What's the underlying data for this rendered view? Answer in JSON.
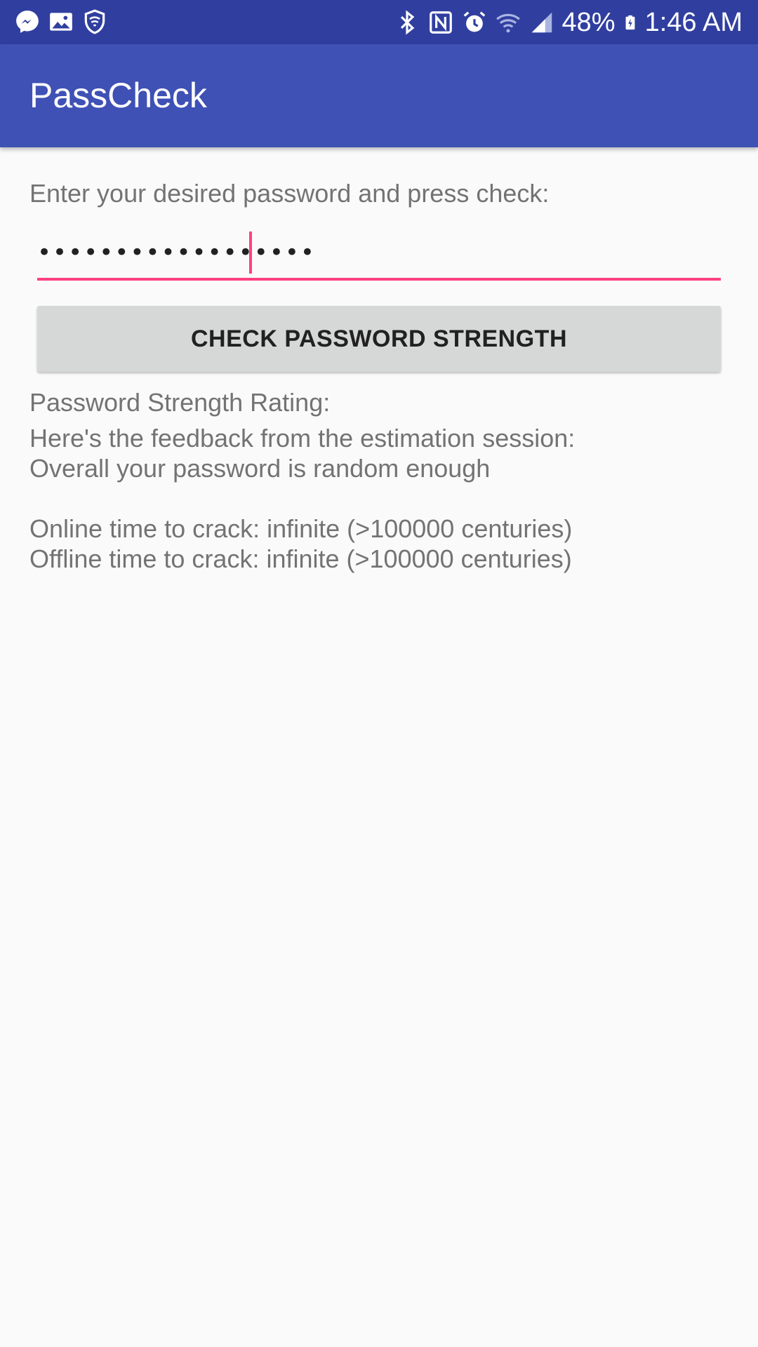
{
  "status_bar": {
    "left_icons": [
      "messenger-icon",
      "image-icon",
      "shield-icon"
    ],
    "right_icons": [
      "bluetooth-icon",
      "nfc-icon",
      "alarm-icon",
      "wifi-icon",
      "signal-icon"
    ],
    "battery_percent": "48%",
    "time": "1:46 AM"
  },
  "app_bar": {
    "title": "PassCheck"
  },
  "form": {
    "prompt": "Enter your desired password and press check:",
    "password_masked": "••••••••••••••••••",
    "check_button_label": "CHECK PASSWORD STRENGTH"
  },
  "results": {
    "rating_label": "Password Strength Rating:",
    "feedback_header": "Here's the feedback from the estimation session:",
    "feedback_summary": "Overall your password is random enough",
    "online_crack": "Online time to crack: infinite (>100000 centuries)",
    "offline_crack": "Offline time to crack: infinite (>100000 centuries)"
  },
  "colors": {
    "status_bar": "#303f9f",
    "app_bar": "#3f51b5",
    "accent": "#ff4081",
    "button": "#d6d7d7"
  }
}
